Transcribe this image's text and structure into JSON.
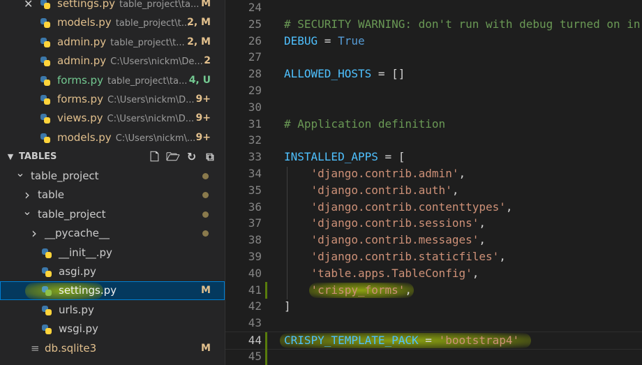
{
  "open_editors": [
    {
      "name": "settings.py",
      "path": "table_project\\ta...",
      "badge": "M",
      "status": "modified",
      "active": true
    },
    {
      "name": "models.py",
      "path": "table_project\\t...",
      "badge": "2, M",
      "status": "modified"
    },
    {
      "name": "admin.py",
      "path": "table_project\\t...",
      "badge": "2, M",
      "status": "modified"
    },
    {
      "name": "admin.py",
      "path": "C:\\Users\\nickm\\De...",
      "badge": "2",
      "status": "modified"
    },
    {
      "name": "forms.py",
      "path": "table_project\\ta...",
      "badge": "4, U",
      "status": "untracked"
    },
    {
      "name": "forms.py",
      "path": "C:\\Users\\nickm\\D...",
      "badge": "9+",
      "status": "modified"
    },
    {
      "name": "views.py",
      "path": "C:\\Users\\nickm\\D...",
      "badge": "9+",
      "status": "modified"
    },
    {
      "name": "models.py",
      "path": "C:\\Users\\nickm\\...",
      "badge": "9+",
      "status": "modified"
    }
  ],
  "explorer": {
    "section_title": "TABLES",
    "tree": [
      {
        "label": "table_project",
        "indent": 0,
        "chevron": "open",
        "dot": true
      },
      {
        "label": "table",
        "indent": 1,
        "chevron": "closed",
        "dot": true
      },
      {
        "label": "table_project",
        "indent": 1,
        "chevron": "open",
        "dot": true
      },
      {
        "label": "__pycache__",
        "indent": 2,
        "chevron": "closed",
        "dot": true
      },
      {
        "label": "__init__.py",
        "indent": 2,
        "icon": "python"
      },
      {
        "label": "asgi.py",
        "indent": 2,
        "icon": "python"
      },
      {
        "label": "settings.py",
        "indent": 2,
        "icon": "python",
        "badge": "M",
        "selected": true
      },
      {
        "label": "urls.py",
        "indent": 2,
        "icon": "python"
      },
      {
        "label": "wsgi.py",
        "indent": 2,
        "icon": "python"
      },
      {
        "label": "db.sqlite3",
        "indent": 1,
        "icon": "file",
        "badge": "M"
      }
    ]
  },
  "editor": {
    "lines": [
      {
        "num": "24",
        "code": []
      },
      {
        "num": "25",
        "code": [
          {
            "t": "# SECURITY WARNING: don't run with debug turned on in",
            "c": "comment"
          }
        ]
      },
      {
        "num": "26",
        "code": [
          {
            "t": "DEBUG",
            "c": "var"
          },
          {
            "t": " = ",
            "c": "op"
          },
          {
            "t": "True",
            "c": "kw"
          }
        ]
      },
      {
        "num": "27",
        "code": []
      },
      {
        "num": "28",
        "code": [
          {
            "t": "ALLOWED_HOSTS",
            "c": "var"
          },
          {
            "t": " = []",
            "c": "op"
          }
        ]
      },
      {
        "num": "29",
        "code": []
      },
      {
        "num": "30",
        "code": []
      },
      {
        "num": "31",
        "code": [
          {
            "t": "# Application definition",
            "c": "comment"
          }
        ]
      },
      {
        "num": "32",
        "code": []
      },
      {
        "num": "33",
        "code": [
          {
            "t": "INSTALLED_APPS",
            "c": "var"
          },
          {
            "t": " = [",
            "c": "op"
          }
        ]
      },
      {
        "num": "34",
        "code": [
          {
            "t": "    ",
            "c": "op"
          },
          {
            "t": "'django.contrib.admin'",
            "c": "str"
          },
          {
            "t": ",",
            "c": "op"
          }
        ]
      },
      {
        "num": "35",
        "code": [
          {
            "t": "    ",
            "c": "op"
          },
          {
            "t": "'django.contrib.auth'",
            "c": "str"
          },
          {
            "t": ",",
            "c": "op"
          }
        ]
      },
      {
        "num": "36",
        "code": [
          {
            "t": "    ",
            "c": "op"
          },
          {
            "t": "'django.contrib.contenttypes'",
            "c": "str"
          },
          {
            "t": ",",
            "c": "op"
          }
        ]
      },
      {
        "num": "37",
        "code": [
          {
            "t": "    ",
            "c": "op"
          },
          {
            "t": "'django.contrib.sessions'",
            "c": "str"
          },
          {
            "t": ",",
            "c": "op"
          }
        ]
      },
      {
        "num": "38",
        "code": [
          {
            "t": "    ",
            "c": "op"
          },
          {
            "t": "'django.contrib.messages'",
            "c": "str"
          },
          {
            "t": ",",
            "c": "op"
          }
        ]
      },
      {
        "num": "39",
        "code": [
          {
            "t": "    ",
            "c": "op"
          },
          {
            "t": "'django.contrib.staticfiles'",
            "c": "str"
          },
          {
            "t": ",",
            "c": "op"
          }
        ]
      },
      {
        "num": "40",
        "code": [
          {
            "t": "    ",
            "c": "op"
          },
          {
            "t": "'table.apps.TableConfig'",
            "c": "str"
          },
          {
            "t": ",",
            "c": "op"
          }
        ]
      },
      {
        "num": "41",
        "code": [
          {
            "t": "    ",
            "c": "op"
          },
          {
            "t": "'crispy_forms'",
            "c": "str"
          },
          {
            "t": ",",
            "c": "op"
          }
        ],
        "modified": true
      },
      {
        "num": "42",
        "code": [
          {
            "t": "]",
            "c": "op"
          }
        ]
      },
      {
        "num": "43",
        "code": []
      },
      {
        "num": "44",
        "code": [
          {
            "t": "CRISPY_TEMPLATE_PACK",
            "c": "var"
          },
          {
            "t": " = ",
            "c": "op"
          },
          {
            "t": "'bootstrap4'",
            "c": "str"
          }
        ],
        "active": true,
        "modified": true
      },
      {
        "num": "45",
        "code": [],
        "modified": true
      }
    ]
  }
}
